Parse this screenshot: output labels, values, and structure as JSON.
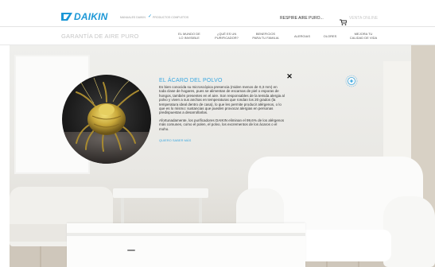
{
  "header": {
    "logo_text": "DAIKIN",
    "small_link": "MANUALES DAIKIN",
    "secure_text": "PRODUCTOS COMPLETOS",
    "check_glyph": "✓",
    "breathe_label": "RESPIRE AIRE PURO...",
    "shop_label": "VENTA ONLINE",
    "cart_icon": "cart-icon",
    "brand_color": "#1b97d6"
  },
  "nav": {
    "title": "GARANTÍA DE AIRE PURO",
    "items": [
      {
        "label": "EL MUNDO DE\nLO INVISIBLE"
      },
      {
        "label": "¿QUÉ ES UN\nPURIFICADOR?"
      },
      {
        "label": "BENEFICIOS\nPARA TU FAMILIA"
      },
      {
        "label": "ALERGIAS"
      },
      {
        "label": "OLORES"
      },
      {
        "label": "MEJORA TU\nCALIDAD DE VIDA"
      }
    ]
  },
  "popup": {
    "title": "EL ÁCARO DEL POLVO",
    "body": "Es bien conocida su microscópica presencia (miden menos de 0,3 mm) en toda clase de hogares, pues se alimentan de escamas de piel o esporas de hongos, también presentes en el aire. Son responsables de la temida alergia al polvo y viven a sus anchas en temperaturas que rondan los 20 grados (la temperatura ideal dentro de casa), lo que les permite producir alérgenos, o lo que es lo mismo: sustancias que pueden provocar alergias en personas predispuestas a desarrollarlas.",
    "body2": "Afortunadamente, los purificadores DAIKIN eliminan el 99,6% de los alérgenos más comunes, como el polen, el polvo, los excrementos de los ácaros o el moho.",
    "link": "QUIERO SABER MÁS",
    "close_glyph": "✕",
    "accent_color": "#3aa7e0",
    "image_icon": "dust-mite-image"
  },
  "scene": {
    "hotspot_icon": "sparkle-hotspot-icon"
  }
}
